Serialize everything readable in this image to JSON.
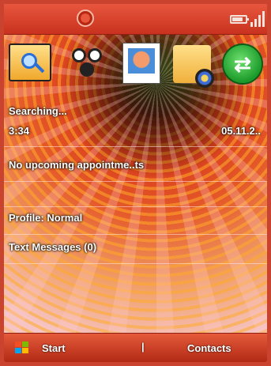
{
  "status_bar": {
    "icons": [
      "windows-logo",
      "battery",
      "signal"
    ]
  },
  "shortcuts": [
    {
      "name": "file-search-icon"
    },
    {
      "name": "media-player-icon"
    },
    {
      "name": "pictures-icon"
    },
    {
      "name": "settings-icon"
    },
    {
      "name": "activesync-icon"
    }
  ],
  "today": {
    "searching": "Searching...",
    "time": "3:34",
    "date": "05.11.2..",
    "appointments": "No upcoming appointme..ts",
    "profile": "Profile: Normal",
    "messages": "Text Messages (0)"
  },
  "softkeys": {
    "left": "Start",
    "separator": "|",
    "right": "Contacts"
  },
  "colors": {
    "bar_red": "#c8321e",
    "text": "#ffffff"
  }
}
